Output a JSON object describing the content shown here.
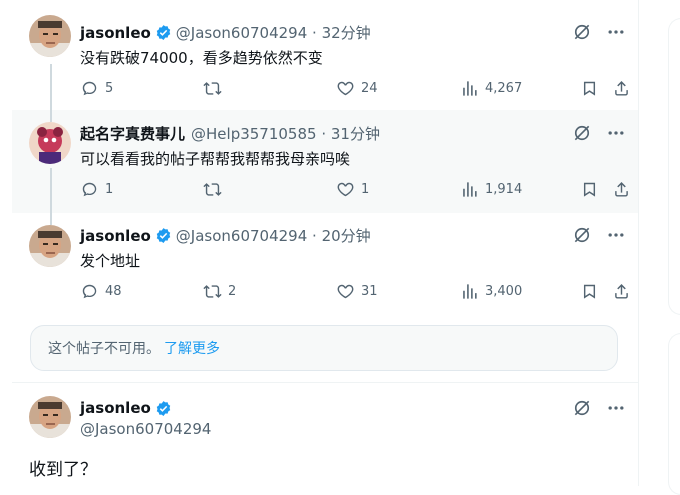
{
  "colors": {
    "verified": "#1d9bf0",
    "link": "#1d9bf0",
    "muted": "#536471",
    "highlight": "#f7f9f9"
  },
  "tweets": [
    {
      "name": "jasonleo",
      "handle": "@Jason60704294",
      "time": "32分钟",
      "verified": true,
      "text": "没有跌破74000，看多趋势依然不变",
      "replies": "5",
      "reposts": "",
      "likes": "24",
      "views": "4,267"
    },
    {
      "name": "起名字真费事儿",
      "handle": "@Help35710585",
      "time": "31分钟",
      "verified": false,
      "text": "可以看看我的帖子帮帮我帮帮我母亲吗唉",
      "replies": "1",
      "reposts": "",
      "likes": "1",
      "views": "1,914"
    },
    {
      "name": "jasonleo",
      "handle": "@Jason60704294",
      "time": "20分钟",
      "verified": true,
      "text": "发个地址",
      "replies": "48",
      "reposts": "2",
      "likes": "31",
      "views": "3,400"
    }
  ],
  "unavailable": {
    "text": "这个帖子不可用。",
    "link": "了解更多"
  },
  "main_tweet": {
    "name": "jasonleo",
    "handle": "@Jason60704294",
    "text": "收到了？"
  },
  "sep": " · "
}
